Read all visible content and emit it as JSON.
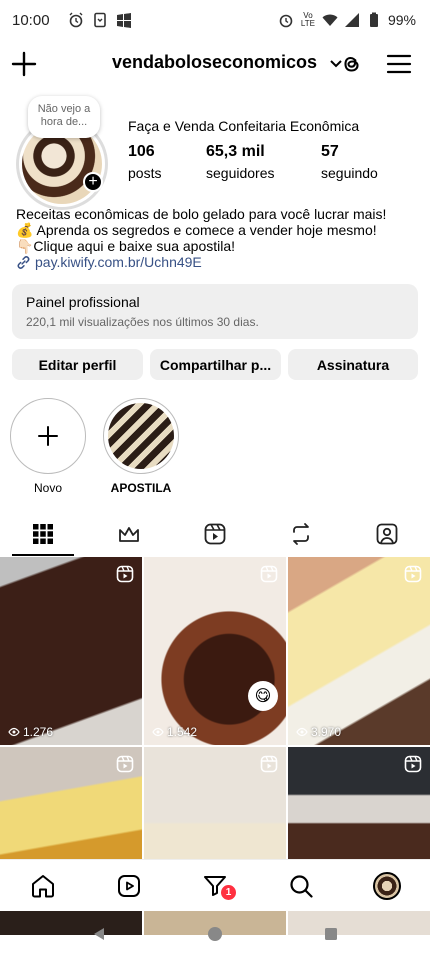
{
  "status_bar": {
    "time": "10:00",
    "battery": "99%",
    "network": "Vo LTE"
  },
  "header": {
    "username": "vendaboloseconomicos"
  },
  "profile": {
    "note": "Não vejo a hora de...",
    "display_name": "Faça e Venda Confeitaria Econômica",
    "stats": [
      {
        "value": "106",
        "label": "posts"
      },
      {
        "value": "65,3 mil",
        "label": "seguidores"
      },
      {
        "value": "57",
        "label": "seguindo"
      }
    ],
    "bio_lines": [
      "Receitas econômicas de bolo gelado para você lucrar mais!",
      "💰 Aprenda os segredos e comece a vender hoje mesmo!",
      "👇🏻Clique aqui e baixe sua apostila!"
    ],
    "link": "pay.kiwify.com.br/Uchn49E"
  },
  "pro_panel": {
    "title": "Painel profissional",
    "subtitle": "220,1 mil visualizações nos últimos 30 dias."
  },
  "actions": {
    "edit": "Editar perfil",
    "share": "Compartilhar p...",
    "subscription": "Assinatura"
  },
  "highlights": [
    {
      "label": "Novo"
    },
    {
      "label": "APOSTILA"
    }
  ],
  "grid": [
    {
      "views": "1.276"
    },
    {
      "views": "1.542"
    },
    {
      "views": "3.970"
    },
    {
      "views": ""
    },
    {
      "views": ""
    },
    {
      "views": ""
    }
  ],
  "bottom_nav": {
    "notifications_count": "1"
  }
}
